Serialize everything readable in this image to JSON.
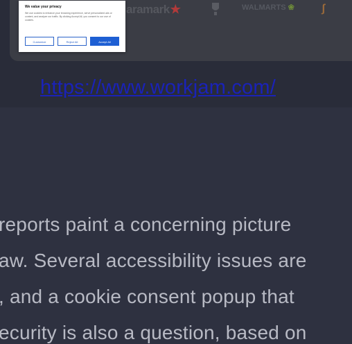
{
  "cookie_popup": {
    "title": "We value your privacy",
    "text": "We use cookies to enhance your browsing experience, serve personalized ads or content, and analyze our traffic. By clicking Accept All, you consent to our use of cookies.",
    "customize_label": "Customize",
    "reject_label": "Reject All",
    "accept_label": "Accept All",
    "accent_color": "#1e5fd3"
  },
  "logos": {
    "aramark": "aramark",
    "walmarts": "WALMARTS",
    "shield_icon": "shield-logo-icon",
    "last_icon": "orange-logo-icon"
  },
  "link": {
    "url_text": "https://www.workjam.com/",
    "color": "#1a22b8"
  },
  "article": {
    "lines": [
      "reports paint a concerning picture",
      "aw. Several accessibility issues are",
      ", and a cookie consent popup that",
      "ecurity is also a question, based on"
    ]
  }
}
